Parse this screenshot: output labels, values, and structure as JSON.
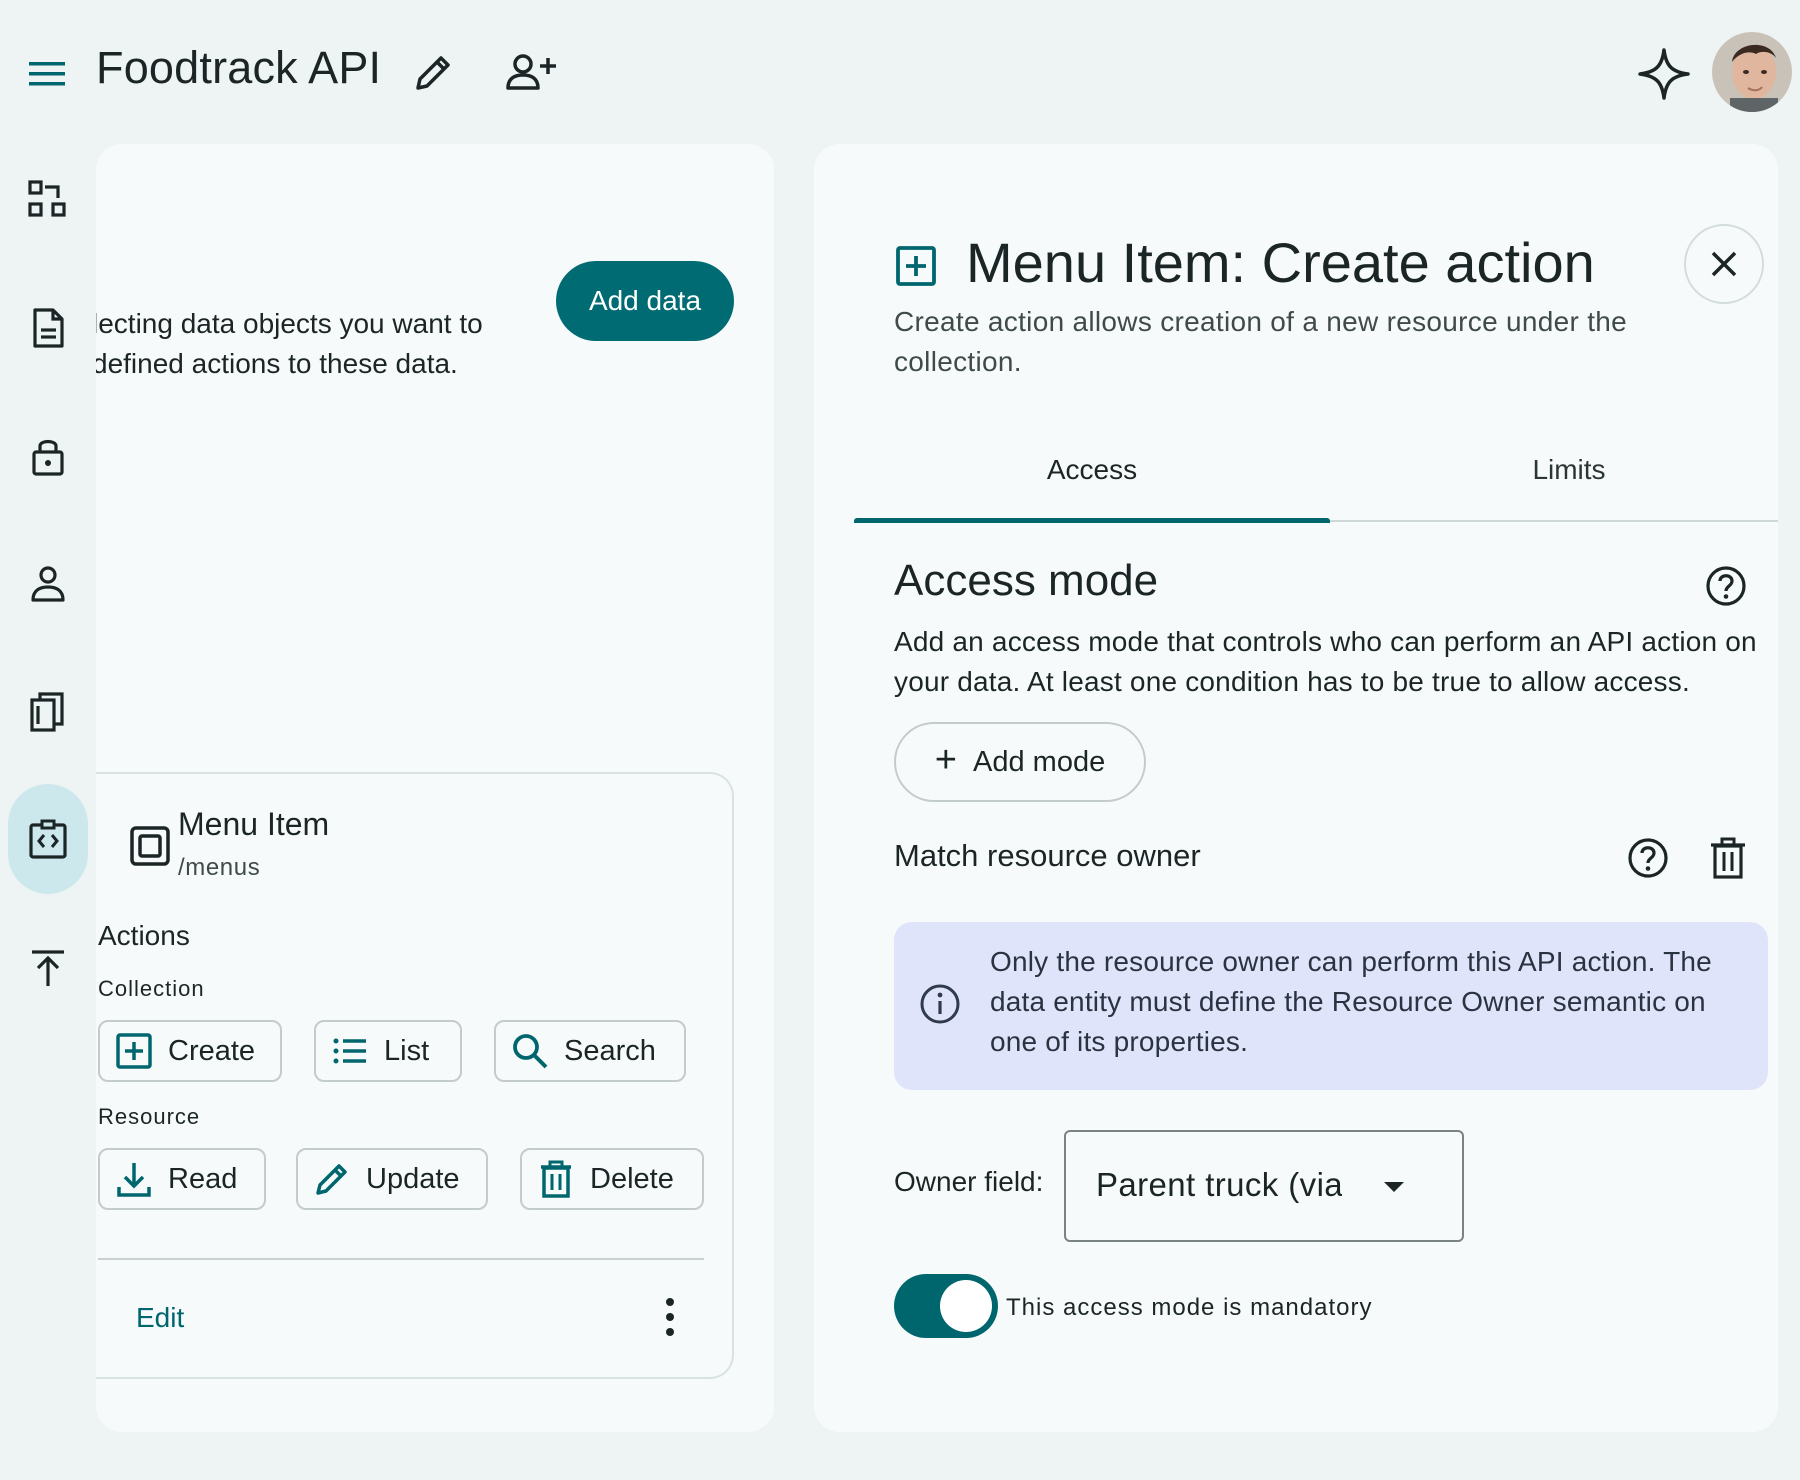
{
  "header": {
    "app_title": "Foodtrack API"
  },
  "nav_rail": {
    "items": [
      {
        "icon": "data-model-icon"
      },
      {
        "icon": "document-icon"
      },
      {
        "icon": "lock-icon"
      },
      {
        "icon": "person-icon"
      },
      {
        "icon": "book-icon"
      },
      {
        "icon": "api-code-icon",
        "active": true
      },
      {
        "icon": "publish-icon"
      }
    ]
  },
  "left_panel": {
    "intro_line1": "lecting data objects you want to",
    "intro_line2": "defined actions to these data.",
    "add_data_label": "Add data",
    "card": {
      "title": "Menu Item",
      "path": "/menus",
      "actions_label": "Actions",
      "collection_label": "Collection",
      "collection_actions": [
        {
          "label": "Create",
          "icon": "add-box-icon"
        },
        {
          "label": "List",
          "icon": "list-icon"
        },
        {
          "label": "Search",
          "icon": "search-icon"
        }
      ],
      "resource_label": "Resource",
      "resource_actions": [
        {
          "label": "Read",
          "icon": "download-icon"
        },
        {
          "label": "Update",
          "icon": "pencil-icon"
        },
        {
          "label": "Delete",
          "icon": "trash-icon"
        }
      ],
      "edit_label": "Edit"
    }
  },
  "right_panel": {
    "title": "Menu Item: Create action",
    "description": "Create action allows creation of a new resource under the collection.",
    "tabs": [
      {
        "label": "Access",
        "selected": true
      },
      {
        "label": "Limits",
        "selected": false
      }
    ],
    "access_mode": {
      "title": "Access mode",
      "description": "Add an access mode that controls who can perform an API action on your data. At least one condition has to be true to allow access.",
      "add_mode_label": "Add mode"
    },
    "match_owner": {
      "title": "Match resource owner",
      "info": "Only the resource owner can perform this API action. The data entity must define the Resource Owner semantic on one of its properties.",
      "owner_field_label": "Owner field:",
      "owner_field_value": "Parent truck (via",
      "mandatory_label": "This access mode is mandatory",
      "mandatory_on": true
    }
  },
  "colors": {
    "accent": "#00666e",
    "background": "#eef3f3",
    "panel": "#f6fafa",
    "info_bg": "#dfe4fb"
  }
}
